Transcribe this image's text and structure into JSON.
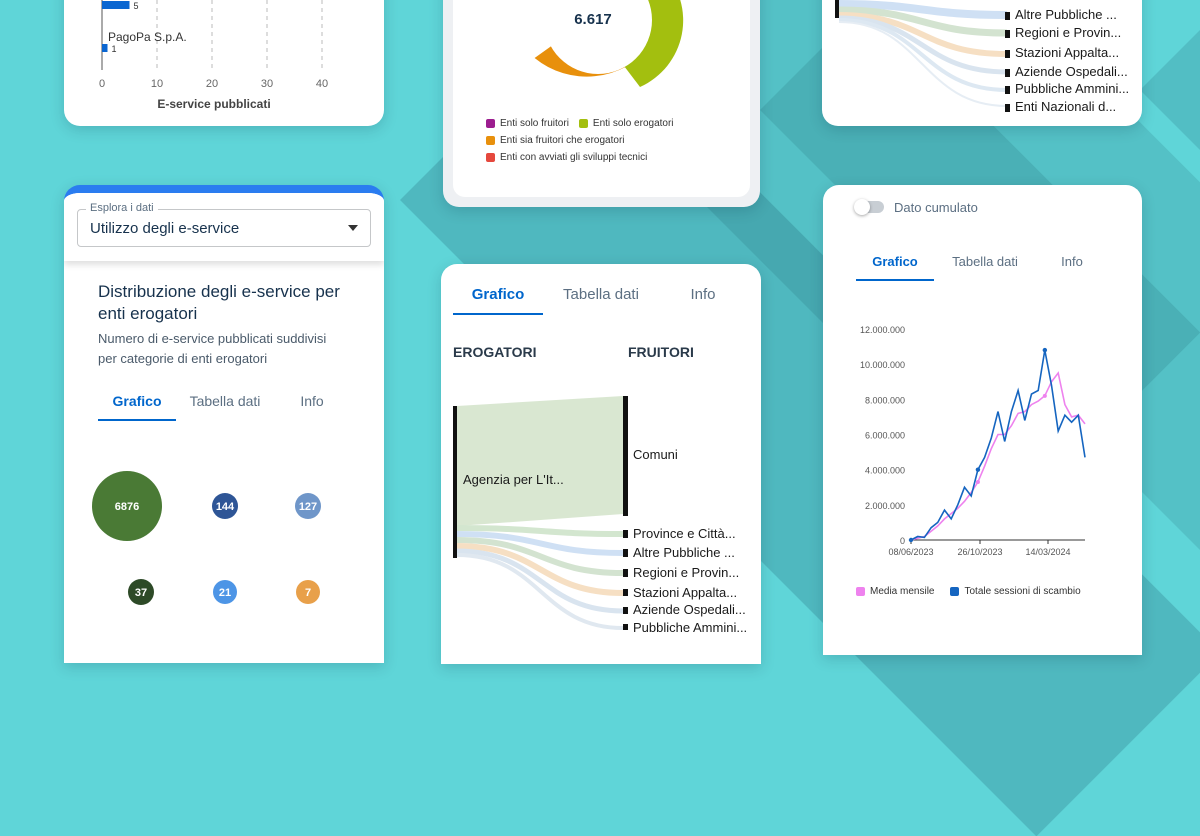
{
  "bar_card": {
    "rows": [
      {
        "label": "",
        "value": 5
      },
      {
        "label": "PagoPa S.p.A.",
        "value": 1
      }
    ],
    "x_ticks": [
      "0",
      "10",
      "20",
      "30",
      "40"
    ],
    "x_label": "E-service pubblicati"
  },
  "donut_card": {
    "center_value": "6.617",
    "legend": [
      {
        "label": "Enti solo fruitori",
        "color": "#9c1d8f"
      },
      {
        "label": "Enti solo erogatori",
        "color": "#a3bf0f"
      },
      {
        "label": "Enti sia fruitori che erogatori",
        "color": "#e8900c"
      },
      {
        "label": "Enti con avviati gli sviluppi tecnici",
        "color": "#e5483d"
      }
    ]
  },
  "sankey_top_card": {
    "labels": [
      "Altre Pubbliche ...",
      "Regioni e Provin...",
      "Stazioni Appalta...",
      "Aziende Ospedali...",
      "Pubbliche Ammini...",
      "Enti Nazionali d..."
    ]
  },
  "explore_card": {
    "select_label": "Esplora i dati",
    "select_value": "Utilizzo degli e-service",
    "title": "Distribuzione degli e-service per enti erogatori",
    "subtitle": "Numero di e-service pubblicati suddivisi per categorie di enti erogatori",
    "tabs": [
      "Grafico",
      "Tabella dati",
      "Info"
    ],
    "bubbles": [
      {
        "value": "6876",
        "color": "#4a7a35"
      },
      {
        "value": "144",
        "color": "#2e5596"
      },
      {
        "value": "127",
        "color": "#6f96c9"
      },
      {
        "value": "37",
        "color": "#2d4a27"
      },
      {
        "value": "21",
        "color": "#4d95e6"
      },
      {
        "value": "7",
        "color": "#e8a04a"
      }
    ]
  },
  "sankey_card": {
    "tabs": [
      "Grafico",
      "Tabella dati",
      "Info"
    ],
    "left_header": "EROGATORI",
    "right_header": "FRUITORI",
    "source_label": "Agenzia per L'It...",
    "targets": [
      "Comuni",
      "Province e Città...",
      "Altre Pubbliche ...",
      "Regioni e Provin...",
      "Stazioni Appalta...",
      "Aziende Ospedali...",
      "Pubbliche Ammini..."
    ]
  },
  "line_card": {
    "toggle_label": "Dato cumulato",
    "tabs": [
      "Grafico",
      "Tabella dati",
      "Info"
    ],
    "legend": [
      {
        "label": "Media mensile",
        "color": "#ee82ee"
      },
      {
        "label": "Totale sessioni di scambio",
        "color": "#1565c0"
      }
    ],
    "chart_data": {
      "type": "line",
      "x_ticks": [
        "08/06/2023",
        "26/10/2023",
        "14/03/2024"
      ],
      "y_ticks": [
        "0",
        "2.000.000",
        "4.000.000",
        "6.000.000",
        "8.000.000",
        "10.000.000",
        "12.000.000"
      ],
      "ylim": [
        0,
        12000000
      ],
      "series": [
        {
          "name": "Totale sessioni di scambio",
          "color": "#1565c0",
          "values": [
            0,
            200000,
            150000,
            700000,
            1000000,
            1700000,
            1200000,
            2000000,
            3000000,
            2500000,
            4000000,
            4700000,
            5800000,
            7300000,
            5600000,
            7300000,
            8500000,
            6800000,
            8300000,
            8500000,
            10800000,
            8800000,
            6200000,
            7100000,
            6700000,
            7100000,
            4700000
          ]
        },
        {
          "name": "Media mensile",
          "color": "#ee82ee",
          "values": [
            0,
            100000,
            200000,
            500000,
            800000,
            1200000,
            1500000,
            1800000,
            2200000,
            2700000,
            3300000,
            4200000,
            5200000,
            6000000,
            6000000,
            6500000,
            7200000,
            7300000,
            7700000,
            7900000,
            8200000,
            9000000,
            9500000,
            7700000,
            7000000,
            7100000,
            6600000
          ]
        }
      ]
    }
  }
}
